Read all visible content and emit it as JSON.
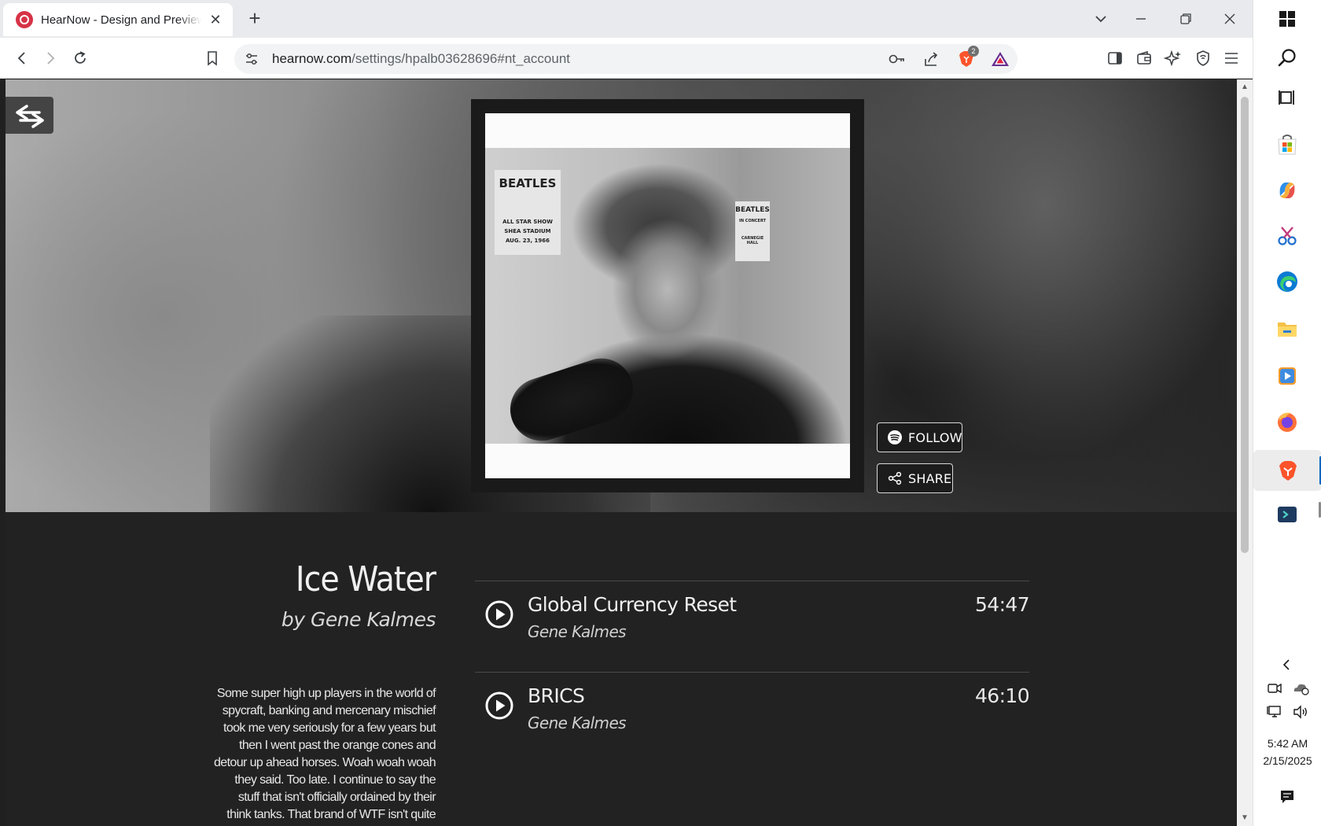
{
  "browser": {
    "tab_title": "HearNow - Design and Preview",
    "tab_close": "✕",
    "new_tab": "+",
    "url_domain": "hearnow.com",
    "url_path": "/settings/hpalb03628696#nt_account",
    "shield_badge": "2",
    "controls": {
      "dropdown": "⌄",
      "minimize": "—",
      "restore": "❐",
      "close": "✕"
    }
  },
  "hero": {
    "follow_label": "FOLLOW",
    "share_label": "SHARE",
    "cover_poster_1": [
      "BEATLES",
      "ALL STAR SHOW",
      "SHEA STADIUM",
      "AUG. 23, 1966"
    ],
    "cover_poster_2": [
      "BEATLES",
      "IN CONCERT",
      "CARNEGIE HALL"
    ]
  },
  "album": {
    "title": "Ice Water",
    "byline": "by Gene Kalmes",
    "description": "Some super high up players in the world of spycraft, banking and mercenary mischief took me very seriously for a few years but then I went past the orange cones and detour up ahead horses. Woah woah woah they said. Too late. I continue to say the stuff that isn't officially ordained by their think tanks. That brand of WTF isn't quite"
  },
  "tracks": [
    {
      "title": "Global Currency Reset",
      "artist": "Gene Kalmes",
      "duration": "54:47"
    },
    {
      "title": "BRICS",
      "artist": "Gene Kalmes",
      "duration": "46:10"
    }
  ],
  "taskbar": {
    "time": "5:42 AM",
    "date": "2/15/2025",
    "apps": [
      "windows-start",
      "search",
      "task-view",
      "microsoft-store",
      "copilot",
      "snipping-tool",
      "edge",
      "file-explorer",
      "media-player",
      "firefox",
      "brave",
      "terminal-app"
    ]
  },
  "colors": {
    "page_bg": "#222222",
    "favicon_red": "#d63347",
    "brave_orange": "#fb542b",
    "accent_blue": "#0067c0"
  }
}
